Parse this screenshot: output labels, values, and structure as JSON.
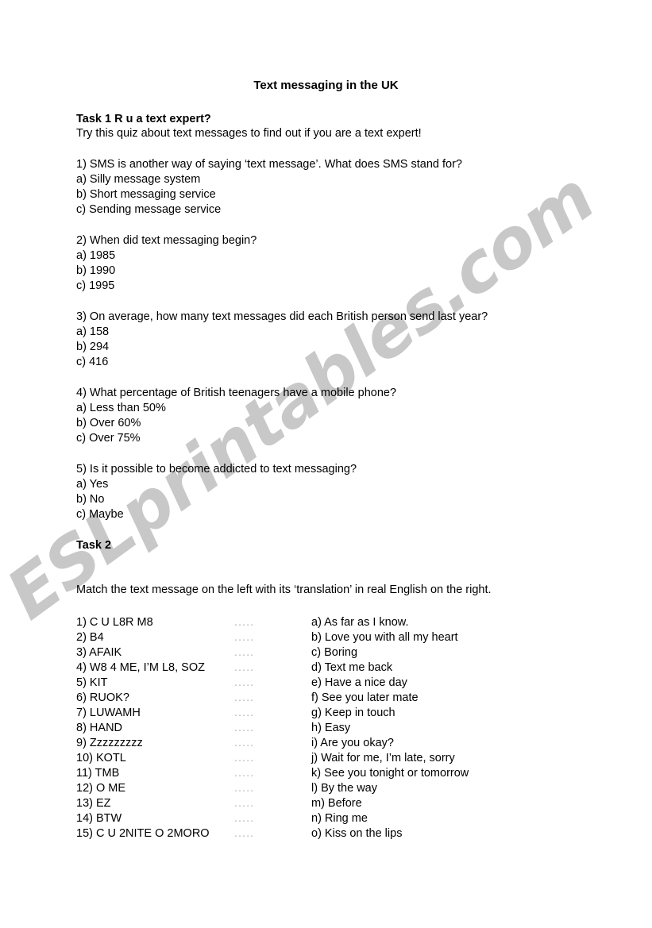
{
  "document": {
    "title": "Text messaging in the UK"
  },
  "task1": {
    "heading": "Task 1 R u a text expert?",
    "intro": "Try this quiz about text messages to find out if you are a text expert!",
    "questions": [
      {
        "number": "1)",
        "text": "1) SMS is another way of saying ‘text message’. What does SMS stand for?",
        "options": [
          "a) Silly message system",
          "b) Short messaging service",
          "c) Sending message service"
        ]
      },
      {
        "number": "2)",
        "text": "2) When did text messaging begin?",
        "options": [
          "a) 1985",
          "b) 1990",
          "c) 1995"
        ]
      },
      {
        "number": "3)",
        "text": "3) On average, how many text messages did each British person send last year?",
        "options": [
          "a) 158",
          "b) 294",
          "c) 416"
        ]
      },
      {
        "number": "4)",
        "text": "4) What percentage of British teenagers have a mobile phone?",
        "options": [
          "a) Less than 50%",
          "b) Over 60%",
          "c) Over 75%"
        ]
      },
      {
        "number": "5)",
        "text": "5) Is it possible to become addicted to text messaging?",
        "options": [
          "a) Yes",
          "b) No",
          "c) Maybe"
        ]
      }
    ]
  },
  "task2": {
    "heading": "Task 2",
    "instruction": "Match the text message on the left with its ‘translation’ in real English on the right.",
    "blank": ".....",
    "rows": [
      {
        "left": "1) C U L8R M8",
        "blank": ".....",
        "right": "a) As far as I know."
      },
      {
        "left": "2) B4",
        "blank": ".....",
        "right": "b) Love you with all my heart"
      },
      {
        "left": "3) AFAIK",
        "blank": ".....",
        "right": "c) Boring"
      },
      {
        "left": "4) W8 4 ME, I’M L8, SOZ",
        "blank": ".....",
        "right": "d) Text me back"
      },
      {
        "left": "5) KIT",
        "blank": ".....",
        "right": "e) Have a nice day"
      },
      {
        "left": "6) RUOK?",
        "blank": ".....",
        "right": "f) See you later mate"
      },
      {
        "left": "7) LUWAMH",
        "blank": ".....",
        "right": "g) Keep in touch"
      },
      {
        "left": "8) HAND",
        "blank": ".....",
        "right": "h) Easy"
      },
      {
        "left": "9) Zzzzzzzzz",
        "blank": ".....",
        "right": "i) Are you okay?"
      },
      {
        "left": "10) KOTL",
        "blank": ".....",
        "right": "j) Wait for me, I’m late, sorry"
      },
      {
        "left": "11) TMB",
        "blank": ".....",
        "right": "k) See you tonight or tomorrow"
      },
      {
        "left": "12) O ME",
        "blank": ".....",
        "right": "l) By the way"
      },
      {
        "left": "13) EZ",
        "blank": ".....",
        "right": "m) Before"
      },
      {
        "left": "14) BTW",
        "blank": ".....",
        "right": "n) Ring me"
      },
      {
        "left": "15) C U 2NITE O 2MORO",
        "blank": ".....",
        "right": "o) Kiss on the lips"
      }
    ]
  },
  "watermark": {
    "text": "ESLprintables.com",
    "color": "#c8c8c8"
  }
}
